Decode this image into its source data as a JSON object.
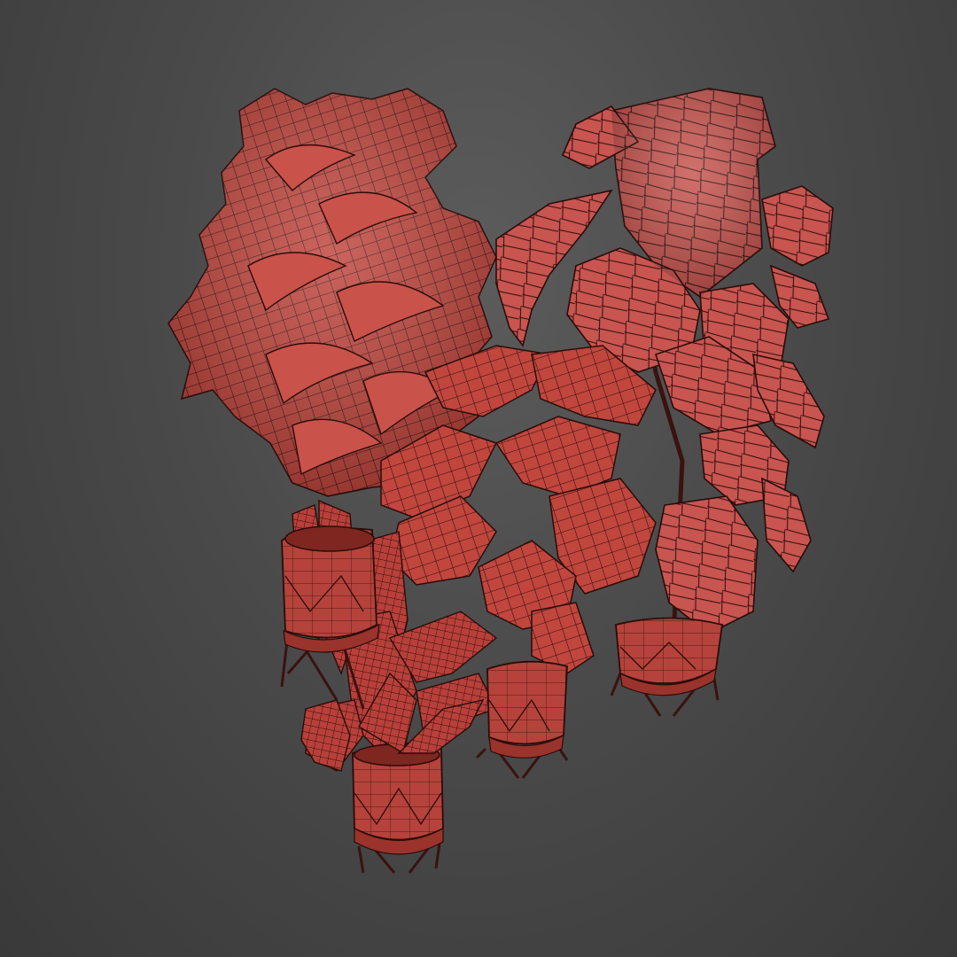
{
  "scene": {
    "view": "3d-viewport-wireframe-render",
    "background_color": "#4a4a4a",
    "mesh_color": "#c0463e",
    "mesh_highlight_color": "#d8756d",
    "mesh_shadow_color": "#8e2a24",
    "wire_color": "#2a0c0a",
    "objects": [
      "palm-plant",
      "ficus-plant",
      "bird-of-paradise-plant",
      "snake-plant",
      "dracaena-plant",
      "pot-with-stand-left",
      "pot-with-stand-center",
      "pot-with-stand-right",
      "pot-with-stand-front"
    ]
  }
}
